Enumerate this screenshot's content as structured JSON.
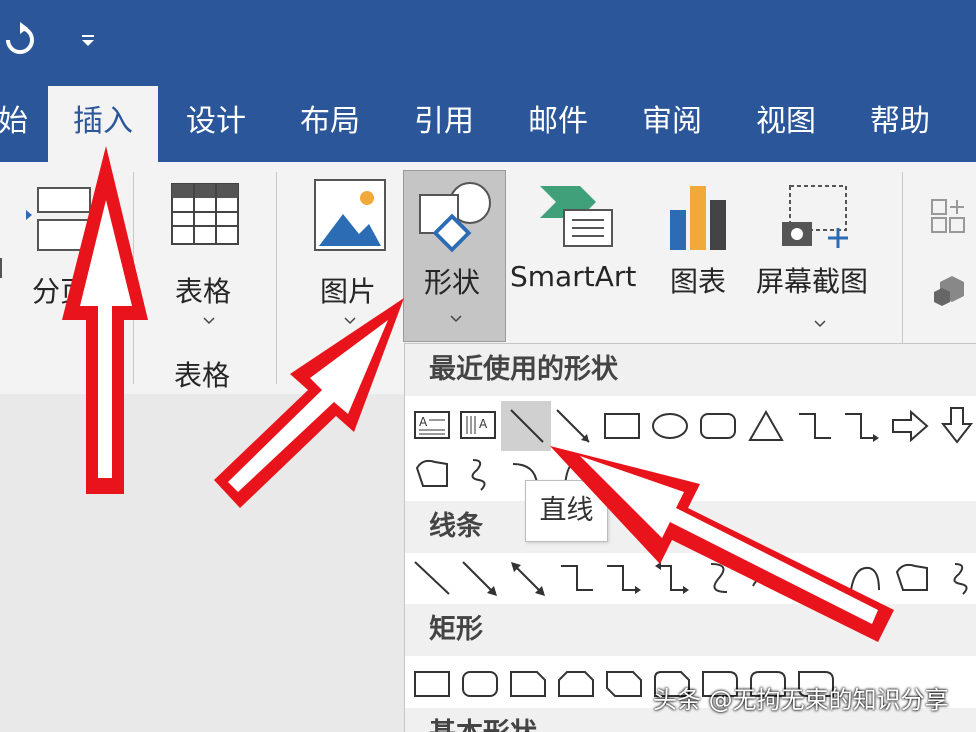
{
  "quick_access": {
    "undo_icon": "undo-icon",
    "customize_icon": "qat-dropdown-icon"
  },
  "tabs": [
    {
      "label": "始",
      "active": false
    },
    {
      "label": "插入",
      "active": true
    },
    {
      "label": "设计",
      "active": false
    },
    {
      "label": "布局",
      "active": false
    },
    {
      "label": "引用",
      "active": false
    },
    {
      "label": "邮件",
      "active": false
    },
    {
      "label": "审阅",
      "active": false
    },
    {
      "label": "视图",
      "active": false
    },
    {
      "label": "帮助",
      "active": false
    }
  ],
  "ribbon": {
    "page_break": {
      "label": "分页"
    },
    "table": {
      "label": "表格",
      "group_label": "表格"
    },
    "picture": {
      "label": "图片"
    },
    "shapes": {
      "label": "形状"
    },
    "smartart": {
      "label": "SmartArt"
    },
    "chart": {
      "label": "图表"
    },
    "screenshot": {
      "label": "屏幕截图"
    }
  },
  "gallery": {
    "sections": [
      {
        "title": "最近使用的形状"
      },
      {
        "title": "线条"
      },
      {
        "title": "矩形"
      },
      {
        "title": "基本形状"
      }
    ],
    "tooltip": "直线"
  },
  "watermark": "头条 @无拘无束的知识分享",
  "colors": {
    "brand": "#2b579a",
    "ribbon": "#f3f3f3",
    "arrow": "#e8131b"
  }
}
